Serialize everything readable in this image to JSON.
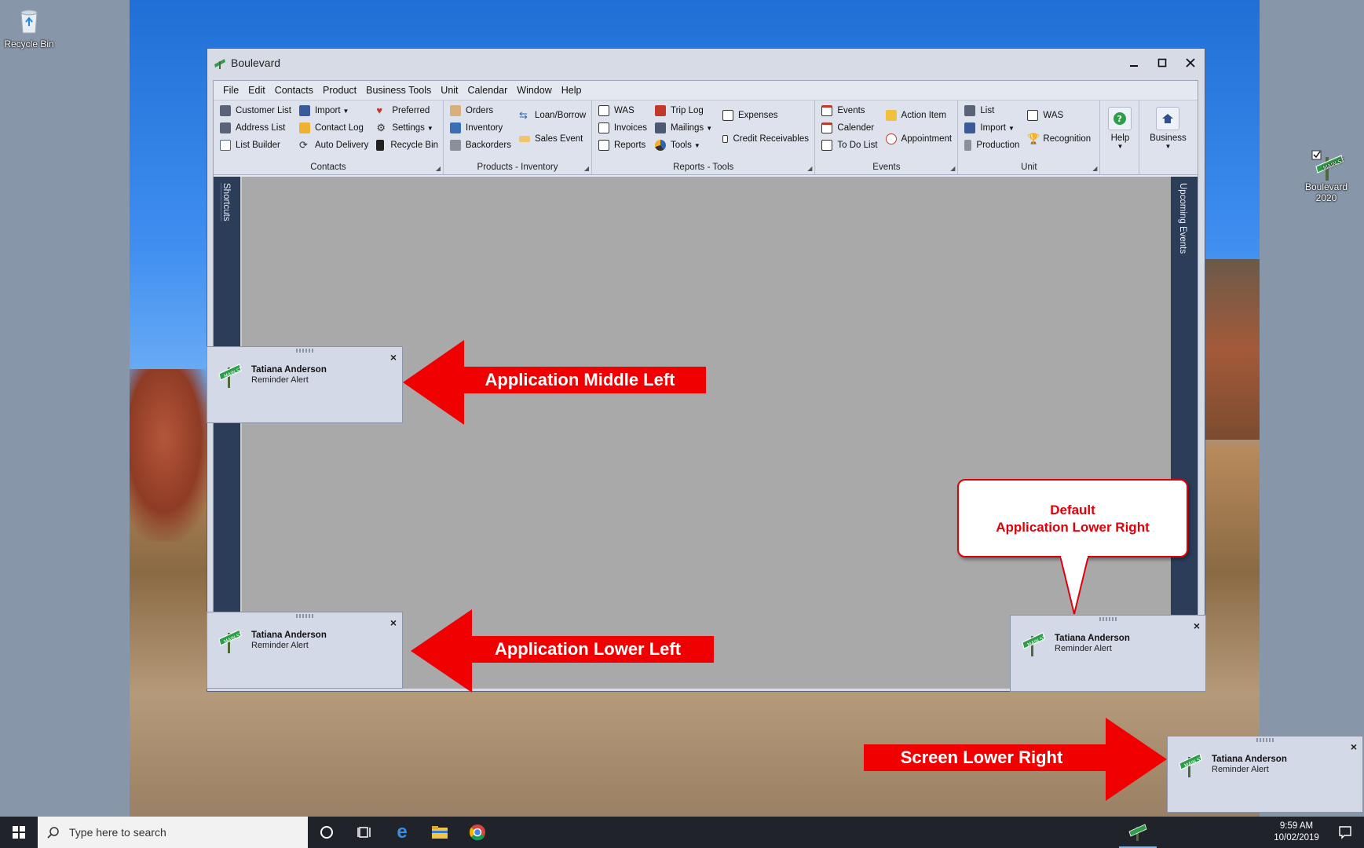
{
  "desktop": {
    "recycle_bin_label": "Recycle Bin",
    "boulevard_icon_label_line1": "Boulevard",
    "boulevard_icon_label_line2": "2020"
  },
  "app": {
    "title": "Boulevard",
    "menu": [
      "File",
      "Edit",
      "Contacts",
      "Product",
      "Business Tools",
      "Unit",
      "Calendar",
      "Window",
      "Help"
    ],
    "ribbon": {
      "contacts": {
        "label": "Contacts",
        "col1": [
          "Customer List",
          "Address List",
          "List Builder"
        ],
        "col2": [
          "Import",
          "Contact Log",
          "Auto Delivery"
        ],
        "col3": [
          "Preferred",
          "Settings",
          "Recycle Bin"
        ]
      },
      "products": {
        "label": "Products - Inventory",
        "col1": [
          "Orders",
          "Inventory",
          "Backorders"
        ],
        "col2": [
          "Loan/Borrow",
          "Sales Event"
        ]
      },
      "reports": {
        "label": "Reports - Tools",
        "col1": [
          "WAS",
          "Invoices",
          "Reports"
        ],
        "col2": [
          "Trip Log",
          "Mailings",
          "Tools"
        ],
        "col3": [
          "Expenses",
          "Credit Receivables"
        ]
      },
      "events": {
        "label": "Events",
        "col1": [
          "Events",
          "Calender",
          "To Do List"
        ],
        "col2": [
          "Action Item",
          "Appointment"
        ]
      },
      "unit": {
        "label": "Unit",
        "col1": [
          "List",
          "Import",
          "Production"
        ],
        "col2": [
          "WAS",
          "Recognition"
        ]
      },
      "help_label": "Help",
      "business_label": "Business"
    },
    "side_left": "Shortcuts",
    "side_right": "Upcoming Events"
  },
  "alert": {
    "name": "Tatiana Anderson",
    "subtitle": "Reminder Alert",
    "close": "×"
  },
  "annotations": {
    "middle_left": "Application Middle Left",
    "lower_left": "Application Lower Left",
    "screen_lower_right": "Screen Lower Right",
    "callout_line1": "Default",
    "callout_line2": "Application Lower Right"
  },
  "taskbar": {
    "search_placeholder": "Type here to search",
    "time": "9:59 AM",
    "date": "10/02/2019"
  },
  "colors": {
    "arrow_red": "#f00000",
    "callout_red": "#e0000a",
    "nav_dark": "#2c3d5a",
    "work_gray": "#a9a9a9"
  }
}
